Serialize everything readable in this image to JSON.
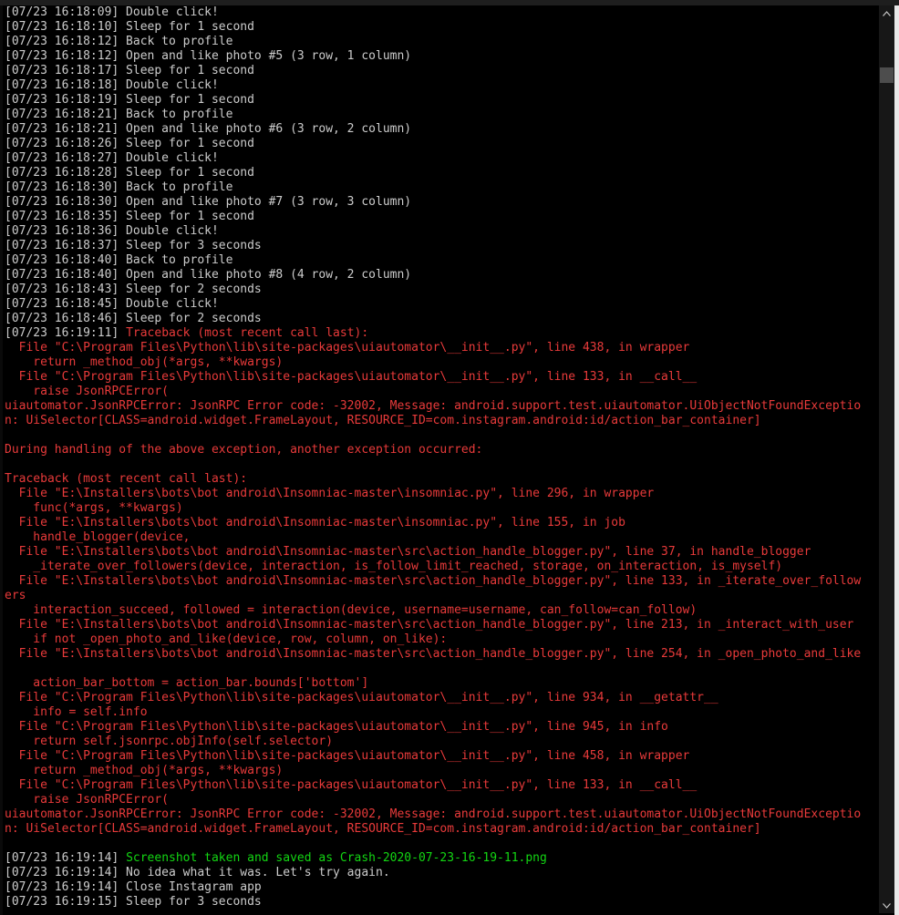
{
  "colors": {
    "background": "#000000",
    "default_text": "#cccccc",
    "error_text": "#e83a3a",
    "success_text": "#13d613",
    "scrollbar_track": "#171717",
    "scrollbar_thumb": "#4d4d4d"
  },
  "icons": {
    "scroll_up": "chevron-up-icon",
    "scroll_down": "chevron-down-icon"
  },
  "lines": [
    {
      "text": "[07/23 16:18:09] Double click!",
      "style": "normal"
    },
    {
      "text": "[07/23 16:18:10] Sleep for 1 second",
      "style": "normal"
    },
    {
      "text": "[07/23 16:18:12] Back to profile",
      "style": "normal"
    },
    {
      "text": "[07/23 16:18:12] Open and like photo #5 (3 row, 1 column)",
      "style": "normal"
    },
    {
      "text": "[07/23 16:18:17] Sleep for 1 second",
      "style": "normal"
    },
    {
      "text": "[07/23 16:18:18] Double click!",
      "style": "normal"
    },
    {
      "text": "[07/23 16:18:19] Sleep for 1 second",
      "style": "normal"
    },
    {
      "text": "[07/23 16:18:21] Back to profile",
      "style": "normal"
    },
    {
      "text": "[07/23 16:18:21] Open and like photo #6 (3 row, 2 column)",
      "style": "normal"
    },
    {
      "text": "[07/23 16:18:26] Sleep for 1 second",
      "style": "normal"
    },
    {
      "text": "[07/23 16:18:27] Double click!",
      "style": "normal"
    },
    {
      "text": "[07/23 16:18:28] Sleep for 1 second",
      "style": "normal"
    },
    {
      "text": "[07/23 16:18:30] Back to profile",
      "style": "normal"
    },
    {
      "text": "[07/23 16:18:30] Open and like photo #7 (3 row, 3 column)",
      "style": "normal"
    },
    {
      "text": "[07/23 16:18:35] Sleep for 1 second",
      "style": "normal"
    },
    {
      "text": "[07/23 16:18:36] Double click!",
      "style": "normal"
    },
    {
      "text": "[07/23 16:18:37] Sleep for 3 seconds",
      "style": "normal"
    },
    {
      "text": "[07/23 16:18:40] Back to profile",
      "style": "normal"
    },
    {
      "text": "[07/23 16:18:40] Open and like photo #8 (4 row, 2 column)",
      "style": "normal"
    },
    {
      "text": "[07/23 16:18:43] Sleep for 2 seconds",
      "style": "normal"
    },
    {
      "text": "[07/23 16:18:45] Double click!",
      "style": "normal"
    },
    {
      "text": "[07/23 16:18:46] Sleep for 2 seconds",
      "style": "normal"
    },
    {
      "timestamp": "[07/23 16:19:11] ",
      "message": "Traceback (most recent call last):",
      "style": "mixed-error"
    },
    {
      "text": "  File \"C:\\Program Files\\Python\\lib\\site-packages\\uiautomator\\__init__.py\", line 438, in wrapper",
      "style": "error"
    },
    {
      "text": "    return _method_obj(*args, **kwargs)",
      "style": "error"
    },
    {
      "text": "  File \"C:\\Program Files\\Python\\lib\\site-packages\\uiautomator\\__init__.py\", line 133, in __call__",
      "style": "error"
    },
    {
      "text": "    raise JsonRPCError(",
      "style": "error"
    },
    {
      "text": "uiautomator.JsonRPCError: JsonRPC Error code: -32002, Message: android.support.test.uiautomator.UiObjectNotFoundExceptio",
      "style": "error"
    },
    {
      "text": "n: UiSelector[CLASS=android.widget.FrameLayout, RESOURCE_ID=com.instagram.android:id/action_bar_container]",
      "style": "error"
    },
    {
      "text": "",
      "style": "error"
    },
    {
      "text": "During handling of the above exception, another exception occurred:",
      "style": "error"
    },
    {
      "text": "",
      "style": "error"
    },
    {
      "text": "Traceback (most recent call last):",
      "style": "error"
    },
    {
      "text": "  File \"E:\\Installers\\bots\\bot android\\Insomniac-master\\insomniac.py\", line 296, in wrapper",
      "style": "error"
    },
    {
      "text": "    func(*args, **kwargs)",
      "style": "error"
    },
    {
      "text": "  File \"E:\\Installers\\bots\\bot android\\Insomniac-master\\insomniac.py\", line 155, in job",
      "style": "error"
    },
    {
      "text": "    handle_blogger(device,",
      "style": "error"
    },
    {
      "text": "  File \"E:\\Installers\\bots\\bot android\\Insomniac-master\\src\\action_handle_blogger.py\", line 37, in handle_blogger",
      "style": "error"
    },
    {
      "text": "    _iterate_over_followers(device, interaction, is_follow_limit_reached, storage, on_interaction, is_myself)",
      "style": "error"
    },
    {
      "text": "  File \"E:\\Installers\\bots\\bot android\\Insomniac-master\\src\\action_handle_blogger.py\", line 133, in _iterate_over_follow",
      "style": "error"
    },
    {
      "text": "ers",
      "style": "error"
    },
    {
      "text": "    interaction_succeed, followed = interaction(device, username=username, can_follow=can_follow)",
      "style": "error"
    },
    {
      "text": "  File \"E:\\Installers\\bots\\bot android\\Insomniac-master\\src\\action_handle_blogger.py\", line 213, in _interact_with_user",
      "style": "error"
    },
    {
      "text": "    if not _open_photo_and_like(device, row, column, on_like):",
      "style": "error"
    },
    {
      "text": "  File \"E:\\Installers\\bots\\bot android\\Insomniac-master\\src\\action_handle_blogger.py\", line 254, in _open_photo_and_like",
      "style": "error"
    },
    {
      "text": "",
      "style": "error"
    },
    {
      "text": "    action_bar_bottom = action_bar.bounds['bottom']",
      "style": "error"
    },
    {
      "text": "  File \"C:\\Program Files\\Python\\lib\\site-packages\\uiautomator\\__init__.py\", line 934, in __getattr__",
      "style": "error"
    },
    {
      "text": "    info = self.info",
      "style": "error"
    },
    {
      "text": "  File \"C:\\Program Files\\Python\\lib\\site-packages\\uiautomator\\__init__.py\", line 945, in info",
      "style": "error"
    },
    {
      "text": "    return self.jsonrpc.objInfo(self.selector)",
      "style": "error"
    },
    {
      "text": "  File \"C:\\Program Files\\Python\\lib\\site-packages\\uiautomator\\__init__.py\", line 458, in wrapper",
      "style": "error"
    },
    {
      "text": "    return _method_obj(*args, **kwargs)",
      "style": "error"
    },
    {
      "text": "  File \"C:\\Program Files\\Python\\lib\\site-packages\\uiautomator\\__init__.py\", line 133, in __call__",
      "style": "error"
    },
    {
      "text": "    raise JsonRPCError(",
      "style": "error"
    },
    {
      "text": "uiautomator.JsonRPCError: JsonRPC Error code: -32002, Message: android.support.test.uiautomator.UiObjectNotFoundExceptio",
      "style": "error"
    },
    {
      "text": "n: UiSelector[CLASS=android.widget.FrameLayout, RESOURCE_ID=com.instagram.android:id/action_bar_container]",
      "style": "error"
    },
    {
      "text": "",
      "style": "normal"
    },
    {
      "timestamp": "[07/23 16:19:14] ",
      "message": "Screenshot taken and saved as Crash-2020-07-23-16-19-11.png",
      "style": "mixed-success"
    },
    {
      "text": "[07/23 16:19:14] No idea what it was. Let's try again.",
      "style": "normal"
    },
    {
      "text": "[07/23 16:19:14] Close Instagram app",
      "style": "normal"
    },
    {
      "text": "[07/23 16:19:15] Sleep for 3 seconds",
      "style": "normal"
    }
  ]
}
